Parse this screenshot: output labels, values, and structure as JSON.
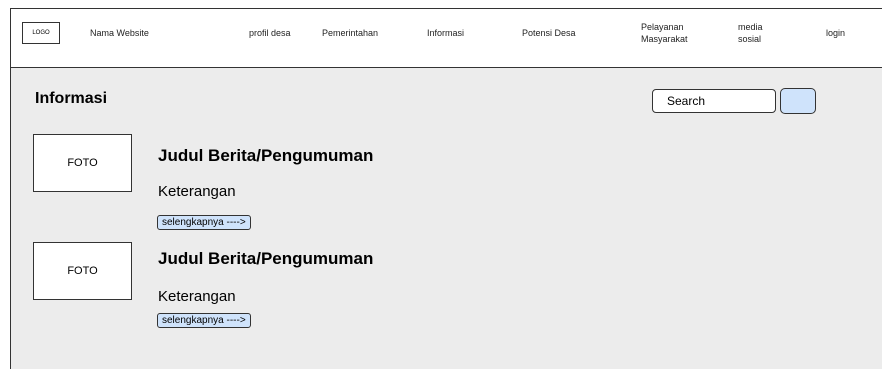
{
  "header": {
    "logo": "LOGO",
    "site_name": "Nama Website",
    "nav": {
      "profil": "profil desa",
      "pemerintahan": "Pemerintahan",
      "informasi": "Informasi",
      "potensi": "Potensi Desa",
      "pelayanan_1": "Pelayanan",
      "pelayanan_2": "Masyarakat",
      "media_1": "media",
      "media_2": "sosial",
      "login": "login"
    }
  },
  "main": {
    "title": "Informasi",
    "search": {
      "label": "Search"
    },
    "items": [
      {
        "photo": "FOTO",
        "title": "Judul Berita/Pengumuman",
        "desc": "Keterangan",
        "more": "selengkapnya ---->"
      },
      {
        "photo": "FOTO",
        "title": "Judul Berita/Pengumuman",
        "desc": "Keterangan",
        "more": "selengkapnya ---->"
      }
    ]
  }
}
